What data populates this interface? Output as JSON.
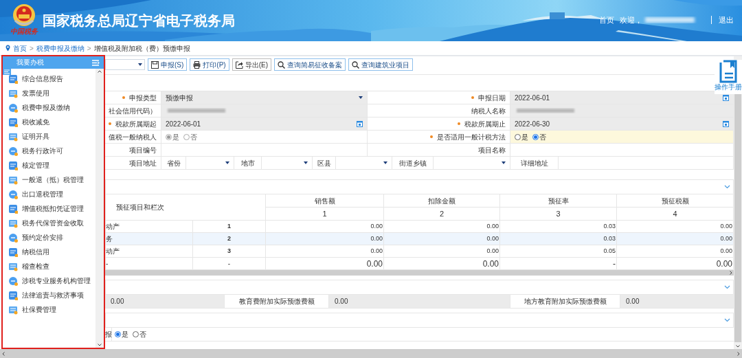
{
  "header": {
    "logo_caption": "中国税务",
    "title": "国家税务总局辽宁省电子税务局",
    "home": "首页",
    "welcome": "欢迎，",
    "logout": "退出"
  },
  "breadcrumb": [
    {
      "kind": "link",
      "label": "首页"
    },
    {
      "kind": "separator",
      "label": ">"
    },
    {
      "kind": "link",
      "label": "税费申报及缴纳"
    },
    {
      "kind": "separator",
      "label": ">"
    },
    {
      "kind": "current",
      "label": "增值税及附加税（费）预缴申报"
    }
  ],
  "toolbar": [
    {
      "label": "申报(S)"
    },
    {
      "label": "打印(P)"
    },
    {
      "label": "导出(E)"
    },
    {
      "label": "查询简易征收备案"
    },
    {
      "label": "查询建筑业项目"
    }
  ],
  "help": {
    "label": "操作手册"
  },
  "form_rows": [
    {
      "kind": "pair",
      "cells": [
        {
          "kind": "label",
          "text": "申报类型",
          "required": true
        },
        {
          "kind": "select",
          "value": "预缴申报",
          "disabled": true
        },
        {
          "kind": "label",
          "text": "申报日期",
          "required": true
        },
        {
          "kind": "date",
          "value": "2022-06-01",
          "disabled": true
        }
      ]
    },
    {
      "kind": "pair",
      "cells": [
        {
          "kind": "label",
          "text": "社会信用代码）"
        },
        {
          "kind": "blurred",
          "disabled": true
        },
        {
          "kind": "label",
          "text": "纳税人名称",
          "required": false
        },
        {
          "kind": "blurred",
          "disabled": true
        }
      ]
    },
    {
      "kind": "pair",
      "cells": [
        {
          "kind": "label",
          "text": "税款所属期起",
          "required": true
        },
        {
          "kind": "date",
          "value": "2022-06-01",
          "disabled": true
        },
        {
          "kind": "label",
          "text": "税款所属期止",
          "required": true
        },
        {
          "kind": "date",
          "value": "2022-06-30",
          "disabled": true
        }
      ]
    },
    {
      "kind": "pair",
      "cells": [
        {
          "kind": "label",
          "text": "值税一般纳税人"
        },
        {
          "kind": "radio",
          "disabled": true,
          "highlighted": false,
          "options": [
            {
              "label": "是",
              "selected": true
            },
            {
              "label": "否",
              "selected": false
            }
          ]
        },
        {
          "kind": "label",
          "text": "是否适用一般计税方法",
          "required": true
        },
        {
          "kind": "radio",
          "disabled": false,
          "highlighted": true,
          "options": [
            {
              "label": "是",
              "selected": false
            },
            {
              "label": "否",
              "selected": true
            }
          ]
        }
      ]
    },
    {
      "kind": "pair",
      "cells": [
        {
          "kind": "label",
          "text": "项目编号",
          "required": false
        },
        {
          "kind": "text"
        },
        {
          "kind": "label",
          "text": "项目名称",
          "required": false
        },
        {
          "kind": "text"
        }
      ]
    },
    {
      "kind": "address",
      "cells": [
        {
          "kind": "label",
          "text": "项目地址",
          "required": false
        },
        {
          "kind": "sublabel",
          "text": "省份"
        },
        {
          "kind": "select",
          "disabled": false
        },
        {
          "kind": "sublabel",
          "text": "地市"
        },
        {
          "kind": "select",
          "disabled": false
        },
        {
          "kind": "sublabel",
          "text": "区县"
        },
        {
          "kind": "select",
          "disabled": false
        },
        {
          "kind": "sublabel",
          "text": "街道乡镇"
        },
        {
          "kind": "select",
          "disabled": false
        },
        {
          "kind": "sublabel",
          "text": "详细地址"
        },
        {
          "kind": "text"
        }
      ]
    }
  ],
  "table": {
    "header": "预征项目和栏次",
    "columns": [
      {
        "title": "销售额",
        "no": "1"
      },
      {
        "title": "扣除金额",
        "no": "2"
      },
      {
        "title": "预征率",
        "no": "3"
      },
      {
        "title": "预征税额",
        "no": "4"
      }
    ],
    "rows": [
      {
        "kind": "line",
        "item": "动产",
        "line": "1",
        "highlighted": false,
        "values": [
          "0.00",
          "0.00",
          "0.03",
          "0.00"
        ]
      },
      {
        "kind": "line",
        "item": "务",
        "line": "2",
        "highlighted": true,
        "values": [
          "0.00",
          "0.00",
          "0.03",
          "0.00"
        ]
      },
      {
        "kind": "line",
        "item": "动产",
        "line": "3",
        "highlighted": false,
        "values": [
          "0.00",
          "0.00",
          "0.05",
          "0.00"
        ]
      },
      {
        "kind": "total",
        "item": "-",
        "line": "-",
        "highlighted": false,
        "values": [
          "0.00",
          "0.00",
          "-",
          "0.00"
        ]
      }
    ]
  },
  "surcharge_row": [
    {
      "kind": "value",
      "text": "0.00"
    },
    {
      "kind": "label",
      "text": "教育费附加实际预缴费额"
    },
    {
      "kind": "value",
      "text": "0.00"
    },
    {
      "kind": "label",
      "text": "地方教育附加实际预缴费额"
    },
    {
      "kind": "value",
      "text": "0.00"
    }
  ],
  "last_row": {
    "label": "报",
    "options": [
      {
        "label": "是",
        "selected": true
      },
      {
        "label": "否",
        "selected": false
      }
    ]
  },
  "sidebar": {
    "title": "我要办税",
    "items": [
      {
        "label": "综合信息报告"
      },
      {
        "label": "发票使用"
      },
      {
        "label": "税费申报及缴纳"
      },
      {
        "label": "税收减免"
      },
      {
        "label": "证明开具"
      },
      {
        "label": "税务行政许可"
      },
      {
        "label": "核定管理"
      },
      {
        "label": "一般退（抵）税管理"
      },
      {
        "label": "出口退税管理"
      },
      {
        "label": "增值税抵扣凭证管理"
      },
      {
        "label": "税务代保管资金收取"
      },
      {
        "label": "预约定价安排"
      },
      {
        "label": "纳税信用"
      },
      {
        "label": "稽查检查"
      },
      {
        "label": "涉税专业服务机构管理"
      },
      {
        "label": "法律追责与救济事项"
      },
      {
        "label": "社保费管理"
      }
    ]
  }
}
